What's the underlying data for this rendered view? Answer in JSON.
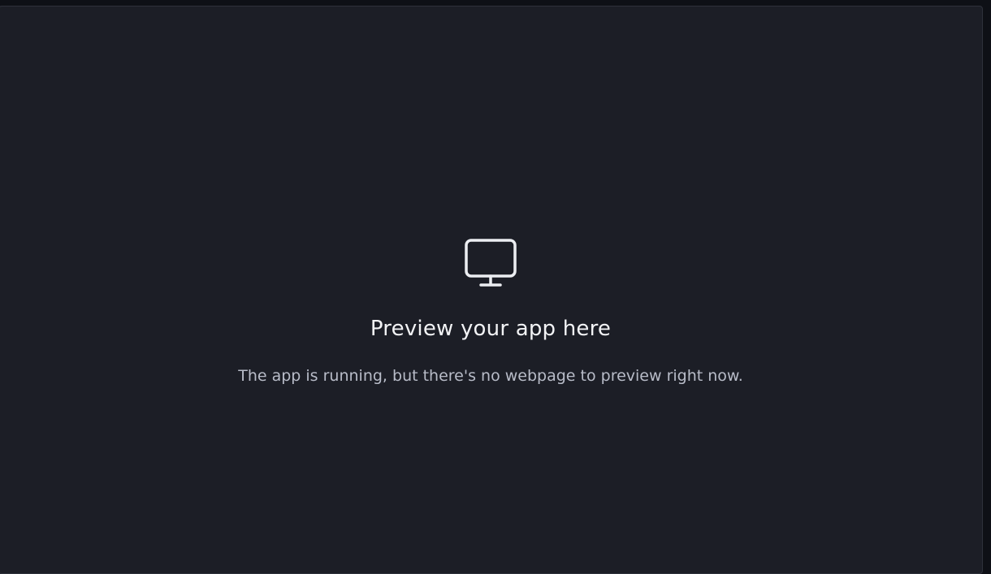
{
  "preview": {
    "icon": "monitor-icon",
    "title": "Preview your app here",
    "subtitle": "The app is running, but there's no webpage to preview right now."
  },
  "colors": {
    "background": "#1c1e26",
    "border": "#2e313b",
    "title": "#f2f3f5",
    "subtitle": "#b8bcc8"
  }
}
